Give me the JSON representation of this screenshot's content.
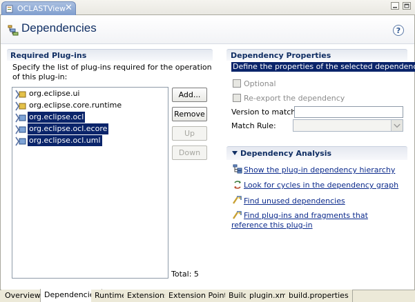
{
  "view_tab": {
    "title": "OCLASTView",
    "icon": "plugin-manifest-icon",
    "close_label": "✕"
  },
  "window_controls": {
    "minimize": "minimize-icon",
    "maximize": "maximize-icon"
  },
  "header": {
    "title": "Dependencies",
    "icon": "dependencies-icon",
    "help_label": "?"
  },
  "required": {
    "title": "Required Plug-ins",
    "description": "Specify the list of plug-ins required for the operation of this plug-in:",
    "items": [
      {
        "label": "org.eclipse.ui",
        "selected": false
      },
      {
        "label": "org.eclipse.core.runtime",
        "selected": false
      },
      {
        "label": "org.eclipse.ocl",
        "selected": true
      },
      {
        "label": "org.eclipse.ocl.ecore",
        "selected": true
      },
      {
        "label": "org.eclipse.ocl.uml",
        "selected": true
      }
    ],
    "buttons": {
      "add": "Add...",
      "remove": "Remove",
      "up": "Up",
      "down": "Down"
    },
    "total": "Total: 5"
  },
  "properties": {
    "title": "Dependency Properties",
    "description": "Define the properties of the selected dependency:",
    "optional_label": "Optional",
    "reexport_label": "Re-export the dependency",
    "version_label": "Version to match:",
    "version_value": "",
    "match_rule_label": "Match Rule:",
    "match_rule_value": ""
  },
  "analysis": {
    "title": "Dependency Analysis",
    "links": {
      "hierarchy": "Show the plug-in dependency hierarchy",
      "cycles": "Look for cycles in the dependency graph",
      "unused": "Find unused dependencies",
      "fragments": "Find plug-ins and fragments that reference this plug-in"
    }
  },
  "bottom_tabs": [
    "Overview",
    "Dependencies",
    "Runtime",
    "Extensions",
    "Extension Points",
    "Build",
    "plugin.xml",
    "build.properties"
  ],
  "active_tab": "Dependencies",
  "colors": {
    "selection": "#0a246a",
    "title": "#102e63",
    "link": "#0b2a8c"
  }
}
